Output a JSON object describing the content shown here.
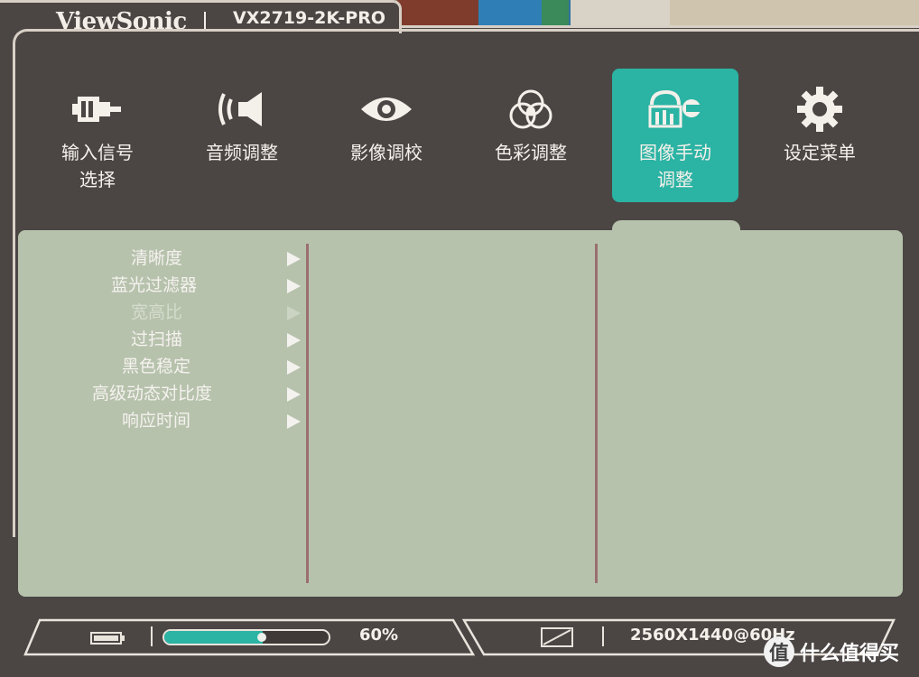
{
  "header": {
    "brand": "ViewSonic",
    "model": "VX2719-2K-PRO"
  },
  "tabs": [
    {
      "label_line1": "输入信号",
      "label_line2": "选择",
      "icon": "input-source-icon",
      "active": false
    },
    {
      "label_line1": "音频调整",
      "label_line2": "",
      "icon": "audio-speaker-icon",
      "active": false
    },
    {
      "label_line1": "影像调校",
      "label_line2": "",
      "icon": "eye-icon",
      "active": false
    },
    {
      "label_line1": "色彩调整",
      "label_line2": "",
      "icon": "color-circles-icon",
      "active": false
    },
    {
      "label_line1": "图像手动",
      "label_line2": "调整",
      "icon": "manual-adjust-icon",
      "active": true
    },
    {
      "label_line1": "设定菜单",
      "label_line2": "",
      "icon": "gear-icon",
      "active": false
    }
  ],
  "submenu": {
    "items": [
      {
        "label": "清晰度",
        "enabled": true
      },
      {
        "label": "蓝光过滤器",
        "enabled": true
      },
      {
        "label": "宽高比",
        "enabled": false
      },
      {
        "label": "过扫描",
        "enabled": true
      },
      {
        "label": "黑色稳定",
        "enabled": true
      },
      {
        "label": "高级动态对比度",
        "enabled": true
      },
      {
        "label": "响应时间",
        "enabled": true
      }
    ]
  },
  "footer": {
    "level_text": "60%",
    "level_value": 0.6,
    "resolution_text": "2560X1440@60Hz"
  },
  "watermark": {
    "badge": "值",
    "text": "什么值得买"
  },
  "colors": {
    "accent": "#2bb3a4",
    "panel": "#b7c2ad",
    "frame": "#4b4644",
    "divider": "#9a6f6f"
  }
}
